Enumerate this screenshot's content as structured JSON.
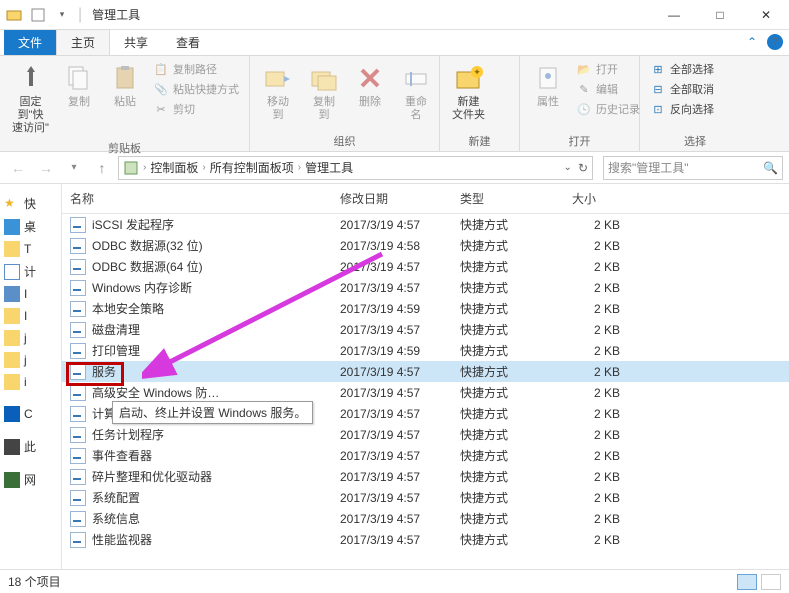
{
  "titlebar": {
    "title": "管理工具"
  },
  "winctrl": {
    "min": "—",
    "max": "□",
    "close": "✕"
  },
  "tabs": {
    "file": "文件",
    "home": "主页",
    "share": "共享",
    "view": "查看"
  },
  "ribbon": {
    "pin": "固定到\"快\n速访问\"",
    "copy": "复制",
    "paste": "粘贴",
    "copypath": "复制路径",
    "pasteshort": "粘贴快捷方式",
    "cut": "剪切",
    "clipboard": "剪贴板",
    "moveto": "移动到",
    "copyto": "复制到",
    "delete": "删除",
    "rename": "重命名",
    "organize": "组织",
    "newfolder": "新建\n文件夹",
    "new": "新建",
    "properties": "属性",
    "open": "打开",
    "edit": "编辑",
    "history": "历史记录",
    "opengrp": "打开",
    "selectall": "全部选择",
    "selectnone": "全部取消",
    "invert": "反向选择",
    "select": "选择"
  },
  "breadcrumb": {
    "parts": [
      "控制面板",
      "所有控制面板项",
      "管理工具"
    ]
  },
  "search": {
    "placeholder": "搜索\"管理工具\""
  },
  "columns": {
    "name": "名称",
    "date": "修改日期",
    "type": "类型",
    "size": "大小"
  },
  "navpane": {
    "quick": "快",
    "desktop": "桌",
    "item3": "T",
    "docs": "计",
    "downloads": "I",
    "music": "I",
    "folder1": "j",
    "folder2": "j",
    "links": "i",
    "onedrive": "C",
    "thispc": "此",
    "network": "网"
  },
  "files": [
    {
      "name": "iSCSI 发起程序",
      "date": "2017/3/19 4:57",
      "type": "快捷方式",
      "size": "2 KB"
    },
    {
      "name": "ODBC 数据源(32 位)",
      "date": "2017/3/19 4:58",
      "type": "快捷方式",
      "size": "2 KB"
    },
    {
      "name": "ODBC 数据源(64 位)",
      "date": "2017/3/19 4:57",
      "type": "快捷方式",
      "size": "2 KB"
    },
    {
      "name": "Windows 内存诊断",
      "date": "2017/3/19 4:57",
      "type": "快捷方式",
      "size": "2 KB"
    },
    {
      "name": "本地安全策略",
      "date": "2017/3/19 4:59",
      "type": "快捷方式",
      "size": "2 KB"
    },
    {
      "name": "磁盘清理",
      "date": "2017/3/19 4:57",
      "type": "快捷方式",
      "size": "2 KB"
    },
    {
      "name": "打印管理",
      "date": "2017/3/19 4:59",
      "type": "快捷方式",
      "size": "2 KB"
    },
    {
      "name": "服务",
      "date": "2017/3/19 4:57",
      "type": "快捷方式",
      "size": "2 KB"
    },
    {
      "name": "高级安全 Windows 防…",
      "date": "2017/3/19 4:57",
      "type": "快捷方式",
      "size": "2 KB"
    },
    {
      "name": "计算机管理",
      "date": "2017/3/19 4:57",
      "type": "快捷方式",
      "size": "2 KB"
    },
    {
      "name": "任务计划程序",
      "date": "2017/3/19 4:57",
      "type": "快捷方式",
      "size": "2 KB"
    },
    {
      "name": "事件查看器",
      "date": "2017/3/19 4:57",
      "type": "快捷方式",
      "size": "2 KB"
    },
    {
      "name": "碎片整理和优化驱动器",
      "date": "2017/3/19 4:57",
      "type": "快捷方式",
      "size": "2 KB"
    },
    {
      "name": "系统配置",
      "date": "2017/3/19 4:57",
      "type": "快捷方式",
      "size": "2 KB"
    },
    {
      "name": "系统信息",
      "date": "2017/3/19 4:57",
      "type": "快捷方式",
      "size": "2 KB"
    },
    {
      "name": "性能监视器",
      "date": "2017/3/19 4:57",
      "type": "快捷方式",
      "size": "2 KB"
    }
  ],
  "tooltip": "启动、终止并设置 Windows 服务。",
  "status": {
    "count": "18 个项目"
  }
}
